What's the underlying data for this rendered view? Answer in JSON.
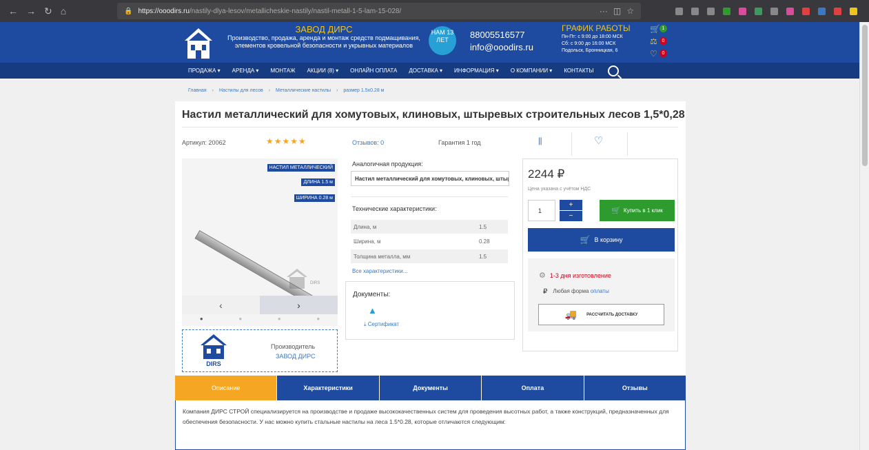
{
  "browser": {
    "url_domain": "https://ooodirs.ru",
    "url_path": "/nastily-dlya-lesov/metallicheskie-nastily/nastil-metall-1-5-lam-15-028/"
  },
  "header": {
    "company_name": "ЗАВОД ДИРС",
    "company_desc": "Производство, продажа, аренда и монтаж средств подмащивания, элементов кровельной безопасности и укрывных материалов",
    "badge": "НАМ 13 ЛЕТ",
    "phone": "88005516577",
    "email": "info@ooodirs.ru",
    "schedule_title": "ГРАФИК РАБОТЫ",
    "schedule_weekdays": "Пн-Пт: с 9:00 до 18:00 МСК",
    "schedule_saturday": "Сб: с 9:00 до 16:00 МСК",
    "schedule_address": "Подольск, Бронницкая, 6",
    "cart_count": "1",
    "compare_count": "0",
    "fav_count": "0"
  },
  "nav": [
    "ПРОДАЖА ▾",
    "АРЕНДА ▾",
    "МОНТАЖ",
    "АКЦИИ (8) ▾",
    "ОНЛАЙН ОПЛАТА",
    "ДОСТАВКА ▾",
    "ИНФОРМАЦИЯ ▾",
    "О КОМПАНИИ ▾",
    "КОНТАКТЫ"
  ],
  "breadcrumb": [
    "Главная",
    "Настилы для лесов",
    "Металлические настилы",
    "размер 1.5х0.28 м"
  ],
  "product": {
    "title": "Настил металлический для хомутовых, клиновых, штыревых строительных лесов 1,5*0,28",
    "sku": "Артикул: 20062",
    "stars": "★★★★★",
    "reviews": "Отзывов: 0",
    "warranty": "Гарантия 1 год",
    "image_tags": [
      "НАСТИЛ МЕТАЛЛИЧЕСКИЙ",
      "ДЛИНА 1.5 м",
      "ШИРИНА 0.28 м"
    ],
    "watermark": "DIRS",
    "manufacturer_label": "Производитель",
    "manufacturer_link": "ЗАВОД ДИРС",
    "manufacturer_logo_text": "DIRS"
  },
  "analog": {
    "label": "Аналогичная продукция:",
    "selected": "Настил металлический для хомутовых, клиновых, штыревых лесов ▾"
  },
  "specs": {
    "label": "Технические характеристики:",
    "rows": [
      {
        "name": "Длина, м",
        "value": "1.5"
      },
      {
        "name": "Ширина, м",
        "value": "0.28"
      },
      {
        "name": "Толщина металла, мм",
        "value": "1.5"
      }
    ],
    "all_link": "Все характеристики..."
  },
  "documents": {
    "label": "Документы:",
    "link": "Сертификат"
  },
  "buy": {
    "price": "2244 ₽",
    "vat_note": "Цена указана с учётом НДС",
    "qty": "1",
    "one_click": "Купить в 1 клик",
    "add_to_cart": "В корзину",
    "manufacturing": "1-3 дня изготовление",
    "payment_prefix": "Любая форма",
    "payment_link": "оплаты",
    "delivery_calc": "РАССЧИТАТЬ ДОСТАВКУ"
  },
  "tabs": [
    "Описание",
    "Характеристики",
    "Документы",
    "Оплата",
    "Отзывы"
  ],
  "description": "Компания ДИРС СТРОЙ специализируется на производстве и продаже высококачественных систем для проведения высотных работ, а также конструкций, предназначенных для обеспечения безопасности. У нас можно купить стальные настилы на леса 1.5*0.28, которые отличаются следующим:",
  "colors": {
    "brand_blue": "#1e4ba0",
    "nav_blue": "#163b80",
    "accent_orange": "#f5a623",
    "buy_green": "#2d9b2d",
    "warning_red": "#d0021b"
  }
}
